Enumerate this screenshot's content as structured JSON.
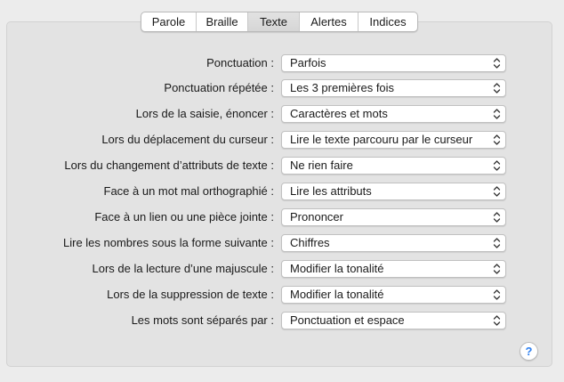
{
  "tabs": [
    {
      "label": "Parole",
      "selected": false
    },
    {
      "label": "Braille",
      "selected": false
    },
    {
      "label": "Texte",
      "selected": true
    },
    {
      "label": "Alertes",
      "selected": false
    },
    {
      "label": "Indices",
      "selected": false
    }
  ],
  "settings": [
    {
      "label": "Ponctuation :",
      "value": "Parfois"
    },
    {
      "label": "Ponctuation répétée :",
      "value": "Les 3 premières fois"
    },
    {
      "label": "Lors de la saisie, énoncer :",
      "value": "Caractères et mots"
    },
    {
      "label": "Lors du déplacement du curseur :",
      "value": "Lire le texte parcouru par le curseur"
    },
    {
      "label": "Lors du changement d’attributs de texte :",
      "value": "Ne rien faire"
    },
    {
      "label": "Face à un mot mal orthographié :",
      "value": "Lire les attributs"
    },
    {
      "label": "Face à un lien ou une pièce jointe :",
      "value": "Prononcer"
    },
    {
      "label": "Lire les nombres sous la forme suivante :",
      "value": "Chiffres"
    },
    {
      "label": "Lors de la lecture d’une majuscule :",
      "value": "Modifier la tonalité"
    },
    {
      "label": "Lors de la suppression de texte :",
      "value": "Modifier la tonalité"
    },
    {
      "label": "Les mots sont séparés par :",
      "value": "Ponctuation et espace"
    }
  ],
  "help": {
    "label": "?",
    "icon": "help-icon"
  },
  "colors": {
    "accent": "#2d7ff0",
    "background": "#ececec",
    "panel": "#e3e3e3"
  }
}
